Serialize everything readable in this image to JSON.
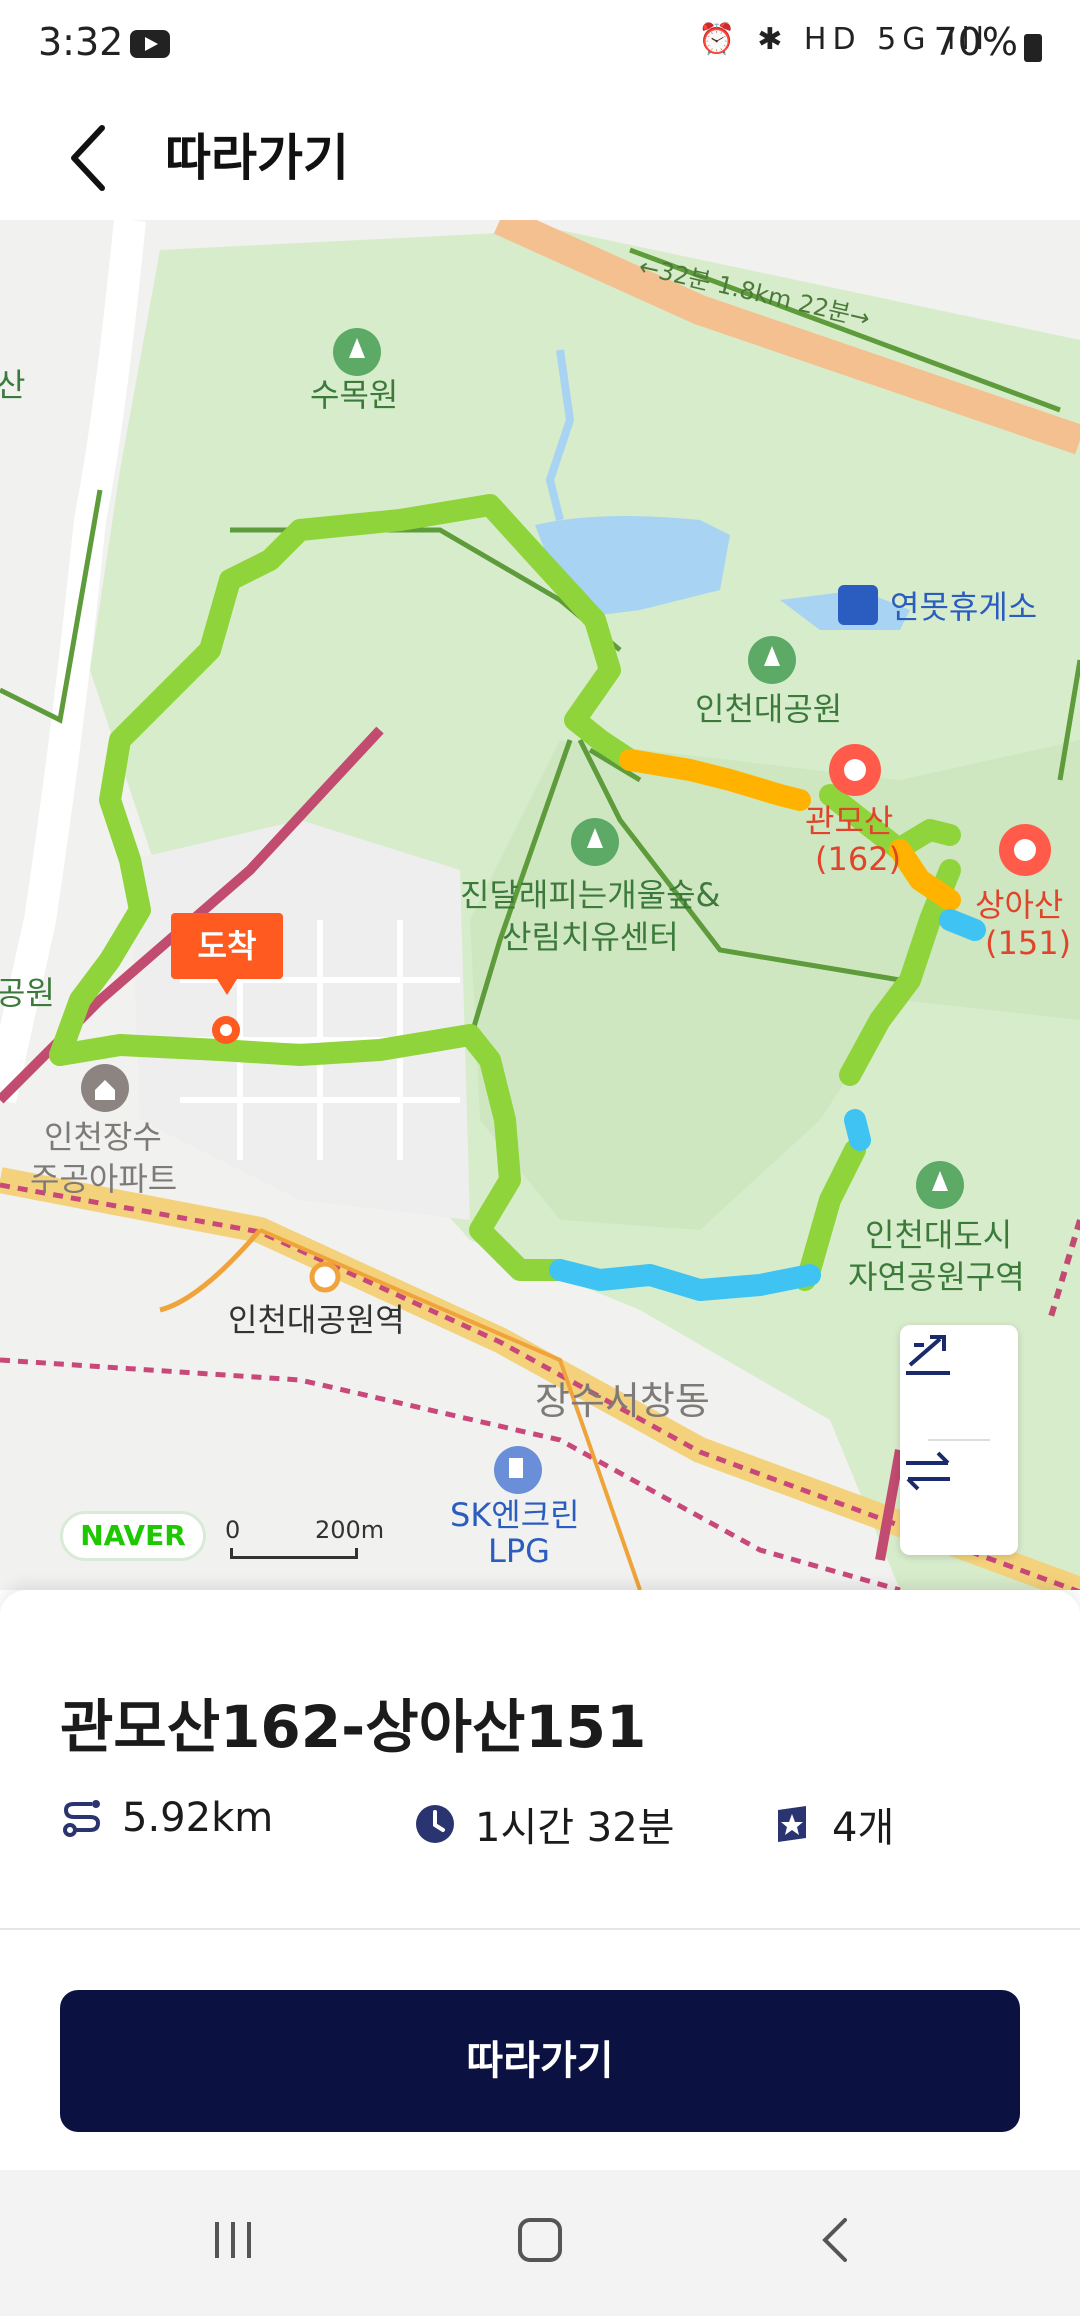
{
  "status_bar": {
    "time": "3:32",
    "icons": "⏰ ✱ HD 5G ıll",
    "battery": "70%"
  },
  "header": {
    "title": "따라가기"
  },
  "map": {
    "labels": {
      "sumokwon": "수목원",
      "rest_area": "연못휴게소",
      "incheon_park": "인천대공원",
      "gwanmosan": "관모산",
      "gwanmosan_height": "(162)",
      "sangasan": "상아산",
      "sangasan_height": "(151)",
      "forest_center_line1": "진달래피는개울숲&",
      "forest_center_line2": "산림치유센터",
      "apartment_line1": "인천장수",
      "apartment_line2": "주공아파트",
      "station": "인천대공원역",
      "city_park_line1": "인천대도시",
      "city_park_line2": "자연공원구역",
      "district": "장수서창동",
      "gas_line1": "SK엔크린",
      "gas_line2": "LPG",
      "road_info": "←32분 1.8km 22분→",
      "edge_left_top": "산",
      "edge_left_mid": "공원"
    },
    "arrival_tag": "도착",
    "naver": "NAVER",
    "scale_zero": "0",
    "scale_label": "200m",
    "accent_green": "#8fd43a",
    "accent_orange": "#ffb300",
    "accent_blue": "#3ec3f2"
  },
  "course": {
    "title": "관모산162-상아산151",
    "distance": "5.92km",
    "duration": "1시간 32분",
    "peaks": "4개"
  },
  "cta": {
    "label": "따라가기"
  }
}
